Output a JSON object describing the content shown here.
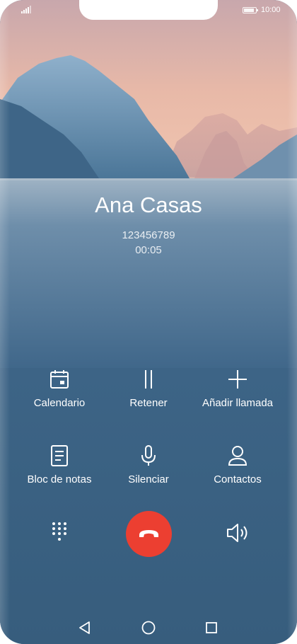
{
  "status_bar": {
    "time": "10:00"
  },
  "call": {
    "contact_name": "Ana Casas",
    "number": "123456789",
    "duration": "00:05"
  },
  "actions": [
    {
      "label": "Calendario",
      "icon": "calendar-icon"
    },
    {
      "label": "Retener",
      "icon": "pause-icon"
    },
    {
      "label": "Añadir llamada",
      "icon": "plus-icon"
    },
    {
      "label": "Bloc de notas",
      "icon": "notes-icon"
    },
    {
      "label": "Silenciar",
      "icon": "microphone-icon"
    },
    {
      "label": "Contactos",
      "icon": "contact-icon"
    }
  ],
  "controls": {
    "dialpad": "dialpad-icon",
    "end_call": "end-call-icon",
    "end_call_color": "#ec3f31",
    "speaker": "speaker-icon"
  },
  "nav_bar": [
    "back-icon",
    "home-icon",
    "recents-icon"
  ]
}
